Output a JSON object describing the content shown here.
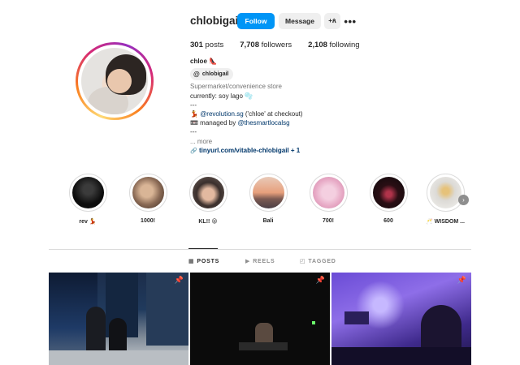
{
  "profile": {
    "username": "chlobigail",
    "follow_label": "Follow",
    "message_label": "Message",
    "add_user_glyph": "+ጰ",
    "more_glyph": "•••"
  },
  "stats": {
    "posts": "301",
    "posts_label": " posts",
    "followers": "7,708",
    "followers_label": " followers",
    "following": "2,108",
    "following_label": " following"
  },
  "bio": {
    "name": "chloe",
    "name_emoji": "👠",
    "threads_handle": "chlobigail",
    "category": "Supermarket/convenience store",
    "line1": "currently: soy lago 🫧",
    "sep1": "---",
    "line2_prefix": "💃 ",
    "line2_mention": "@revolution.sg",
    "line2_suffix": " ('chloe' at checkout)",
    "line3_prefix": "📼 managed by ",
    "line3_mention": "@thesmartlocalsg",
    "sep2": "---",
    "more": "... more",
    "link_icon": "🔗",
    "link": "tinyurl.com/vitable-chlobigail + 1"
  },
  "highlights": [
    {
      "label": "rev 💃"
    },
    {
      "label": "1000!"
    },
    {
      "label": "KL!! 😝"
    },
    {
      "label": "Bali"
    },
    {
      "label": "700!"
    },
    {
      "label": "600"
    },
    {
      "label": "🥂 WISDOM ..."
    }
  ],
  "tabs": [
    {
      "icon": "▦",
      "label": "POSTS"
    },
    {
      "icon": "▶",
      "label": "REELS"
    },
    {
      "icon": "◰",
      "label": "TAGGED"
    }
  ],
  "colors": {
    "accent": "#0095f6",
    "link": "#00376b",
    "muted": "#737373"
  }
}
